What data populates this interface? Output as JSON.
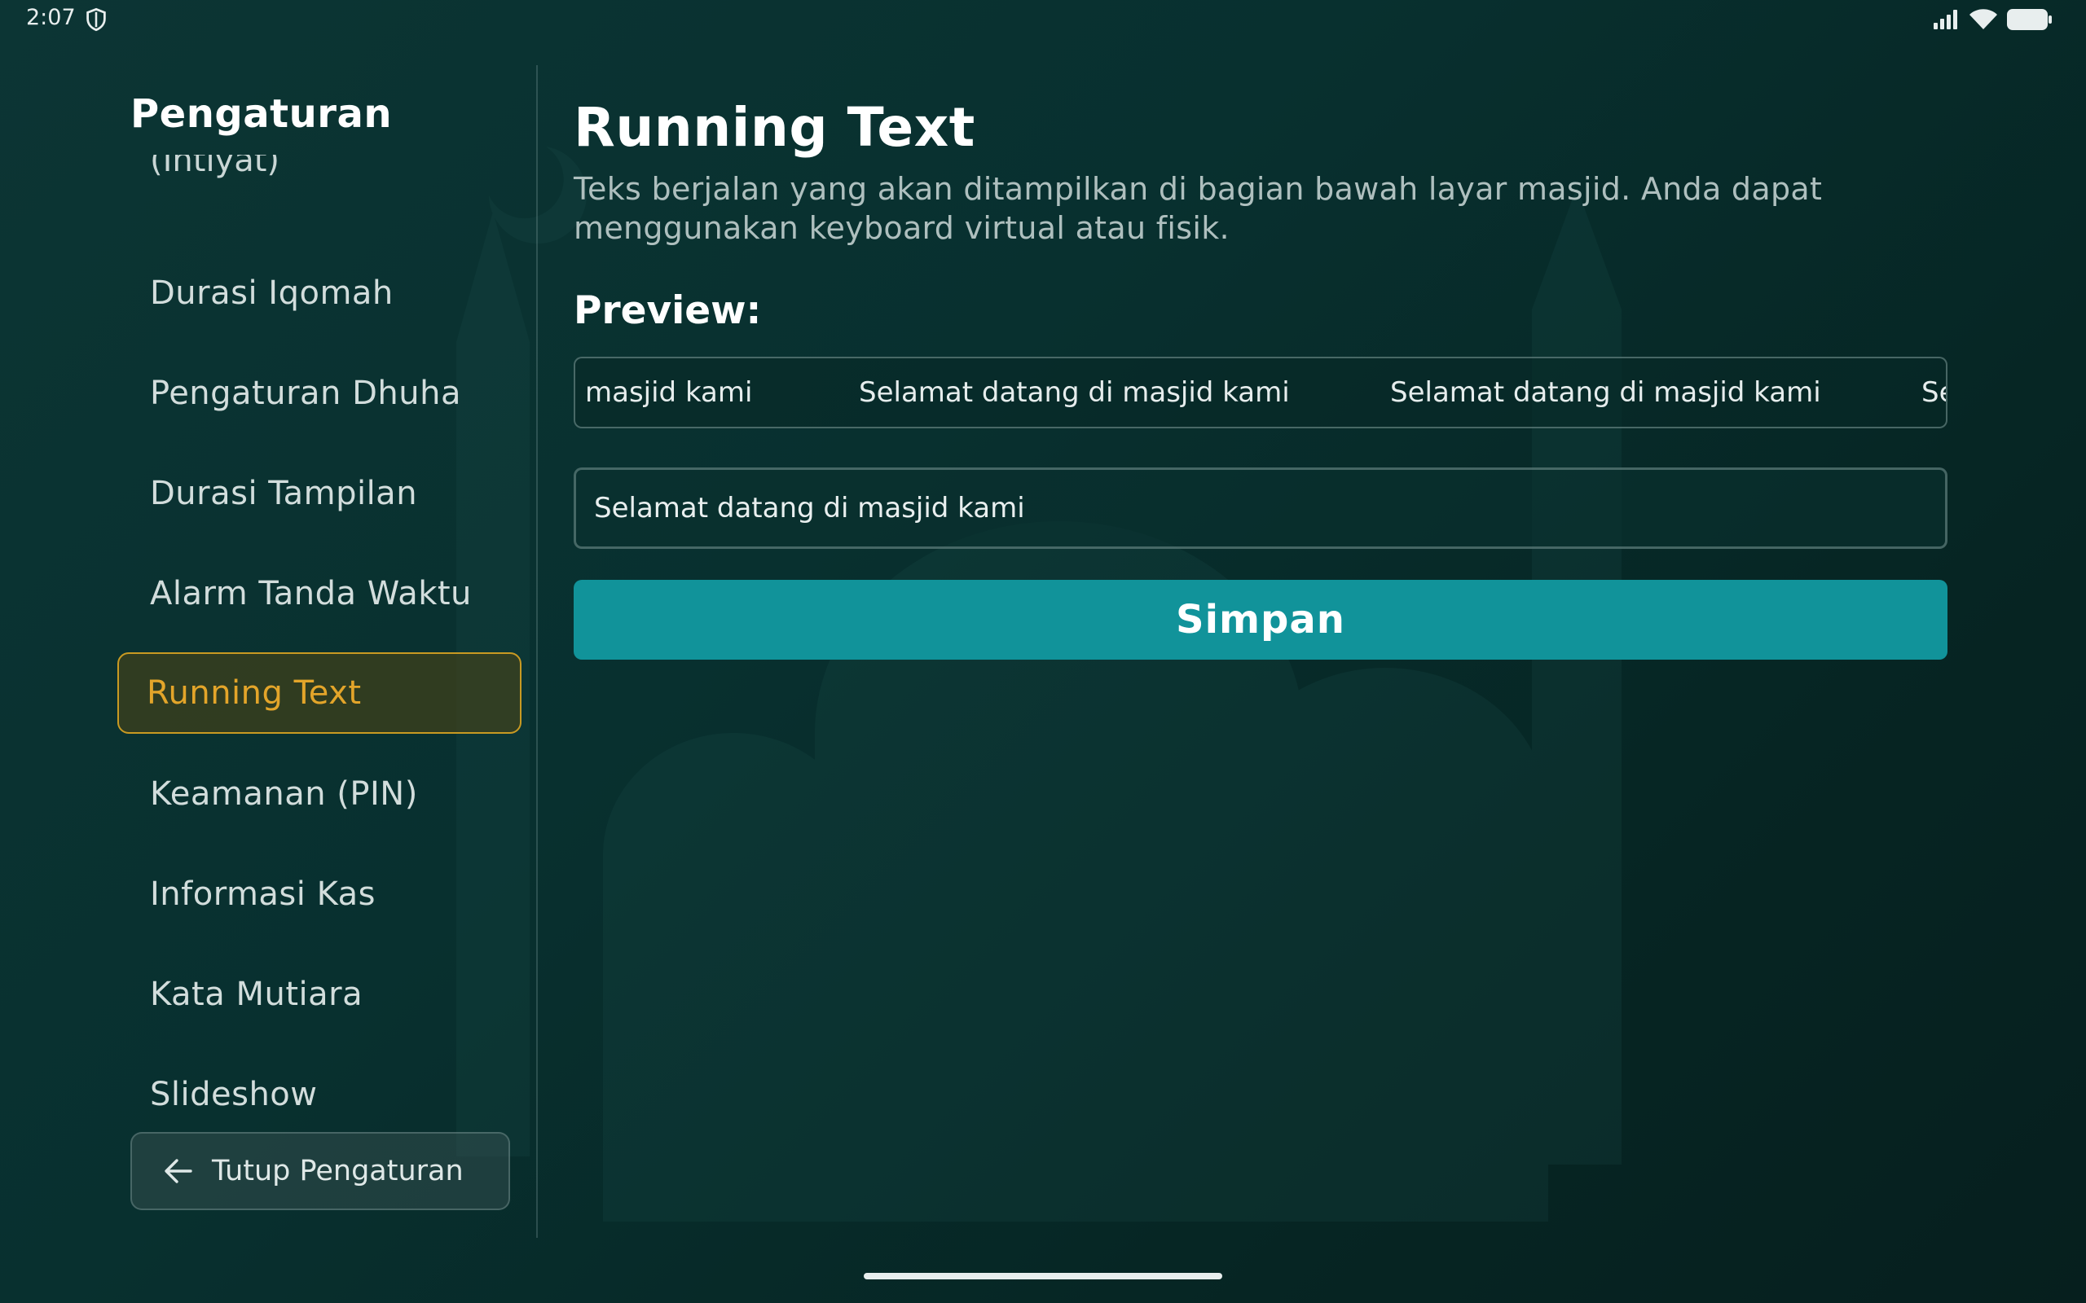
{
  "status_bar": {
    "time": "2:07",
    "icons": [
      "shield-icon",
      "signal-icon",
      "wifi-icon",
      "battery-icon"
    ]
  },
  "sidebar": {
    "title": "Pengaturan",
    "cutoff_item": "(Ihtiyat)",
    "items": [
      {
        "label": "Durasi Iqomah",
        "active": false
      },
      {
        "label": "Pengaturan Dhuha",
        "active": false
      },
      {
        "label": "Durasi Tampilan",
        "active": false
      },
      {
        "label": "Alarm Tanda Waktu",
        "active": false
      },
      {
        "label": "Running Text",
        "active": true
      },
      {
        "label": "Keamanan (PIN)",
        "active": false
      },
      {
        "label": "Informasi Kas",
        "active": false
      },
      {
        "label": "Kata Mutiara",
        "active": false
      },
      {
        "label": "Slideshow",
        "active": false
      }
    ],
    "close_button": {
      "label": "Tutup Pengaturan",
      "icon": "arrow-left-icon"
    }
  },
  "main": {
    "title": "Running Text",
    "description": "Teks berjalan yang akan ditampilkan di bagian bawah layar masjid. Anda dapat menggunakan keyboard virtual atau fisik.",
    "preview_label": "Preview:",
    "preview_segments": [
      "masjid kami",
      "Selamat datang di masjid kami",
      "Selamat datang di masjid kami",
      "Se"
    ],
    "input_value": "Selamat datang di masjid kami",
    "save_label": "Simpan"
  },
  "colors": {
    "accent": "#11939a",
    "active_item_text": "#e3a52a",
    "active_item_border": "#c99a22",
    "background": "#08302f"
  }
}
